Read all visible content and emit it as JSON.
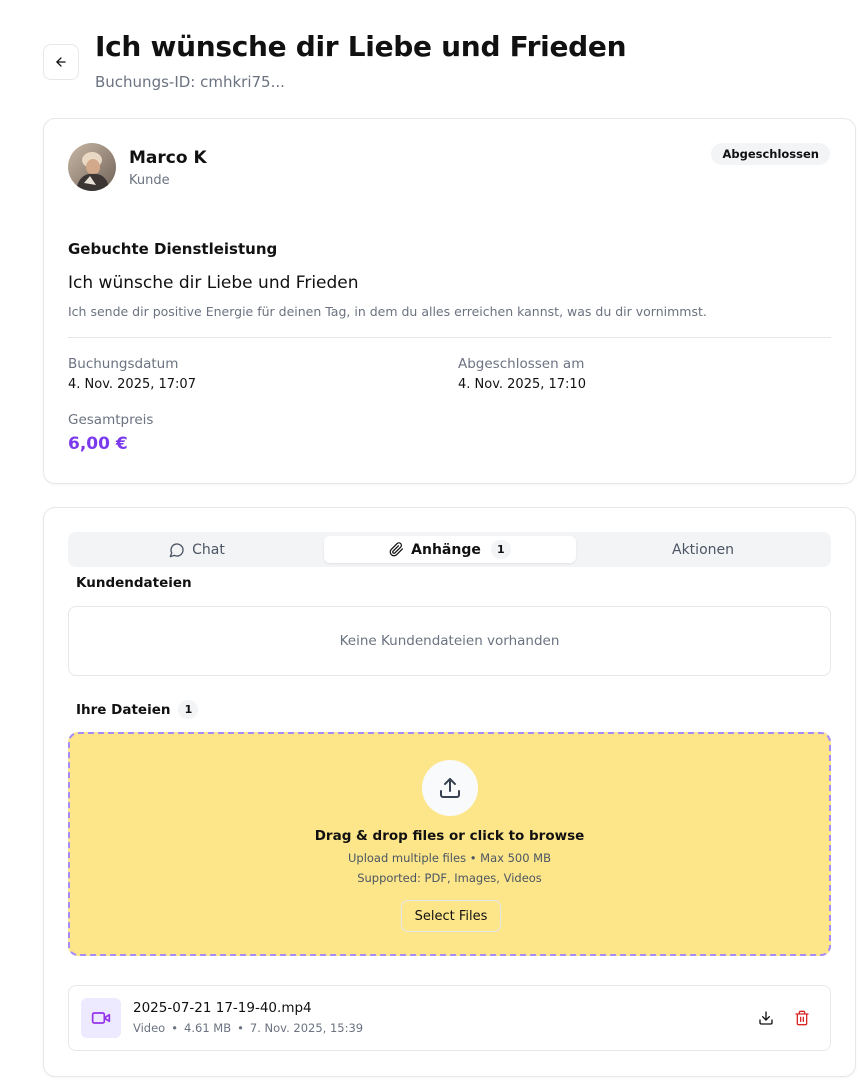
{
  "header": {
    "title": "Ich wünsche dir Liebe und Frieden",
    "booking_id": "Buchungs-ID: cmhkri75..."
  },
  "customer": {
    "name": "Marco K",
    "role": "Kunde",
    "status": "Abgeschlossen"
  },
  "service": {
    "section_title": "Gebuchte Dienstleistung",
    "name": "Ich wünsche dir Liebe und Frieden",
    "description": "Ich sende dir positive Energie für deinen Tag, in dem du alles erreichen kannst, was du dir vornimmst."
  },
  "details": {
    "booking_date_label": "Buchungsdatum",
    "booking_date": "4. Nov. 2025, 17:07",
    "completed_label": "Abgeschlossen am",
    "completed_date": "4. Nov. 2025, 17:10",
    "total_label": "Gesamtpreis",
    "total": "6,00 €",
    "price_color": "#7c3aed"
  },
  "tabs": [
    {
      "label": "Chat",
      "icon": "chat-icon"
    },
    {
      "label": "Anhänge",
      "icon": "paperclip-icon",
      "count": "1",
      "active": true
    },
    {
      "label": "Aktionen"
    }
  ],
  "customer_files": {
    "title": "Kundendateien",
    "empty_text": "Keine Kundendateien vorhanden"
  },
  "your_files": {
    "title": "Ihre Dateien",
    "count": "1"
  },
  "dropzone": {
    "title": "Drag & drop files or click to browse",
    "limits": "Upload multiple files • Max 500 MB",
    "supported": "Supported: PDF, Images, Videos",
    "button": "Select Files",
    "icon": "upload-icon",
    "background": "#fde68a"
  },
  "files": [
    {
      "name": "2025-07-21 17-19-40.mp4",
      "type": "Video",
      "size": "4.61 MB",
      "date": "7. Nov. 2025, 15:39",
      "icon": "video-icon"
    }
  ]
}
